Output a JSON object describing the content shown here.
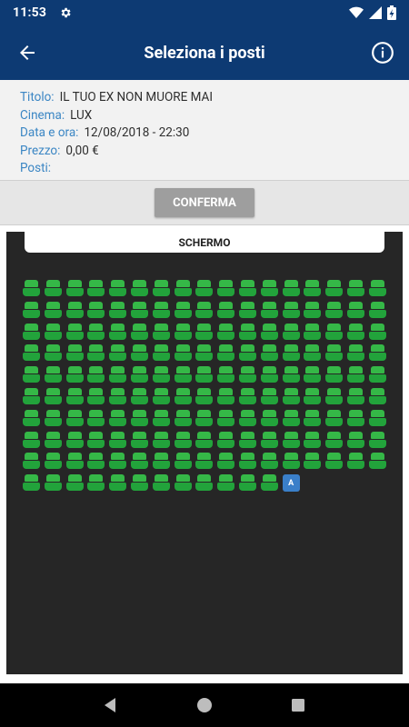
{
  "status_bar": {
    "time": "11:53"
  },
  "app_bar": {
    "title": "Seleziona i posti"
  },
  "details": {
    "title_label": "Titolo:",
    "title_value": "IL TUO EX NON MUORE MAI",
    "cinema_label": "Cinema:",
    "cinema_value": "LUX",
    "datetime_label": "Data e ora:",
    "datetime_value": "12/08/2018 - 22:30",
    "price_label": "Prezzo:",
    "price_value": "0,00 €",
    "seats_label": "Posti:",
    "seats_value": ""
  },
  "confirm_button": {
    "label": "CONFERMA"
  },
  "hall": {
    "screen_label": "SCHERMO",
    "columns": 17,
    "rows": 10,
    "last_row_seat_count": 12,
    "occupied_seat_label": "A"
  },
  "colors": {
    "primary": "#0d3a73",
    "label_blue": "#3b86c4",
    "seat_green": "#22a33b",
    "occupied_blue": "#3a7fc9",
    "button_gray": "#9e9e9e"
  }
}
